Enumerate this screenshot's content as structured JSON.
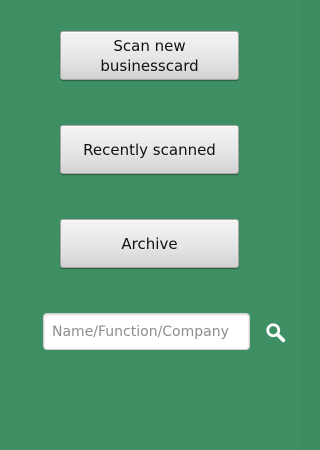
{
  "menu": {
    "scan_label": "Scan new\nbusinesscard",
    "recent_label": "Recently scanned",
    "archive_label": "Archive"
  },
  "search": {
    "value": "",
    "placeholder": "Name/Function/Company",
    "icon": "search-icon"
  },
  "colors": {
    "background": "#3f8f64",
    "button": "#e6e6e6",
    "text": "#111111"
  }
}
